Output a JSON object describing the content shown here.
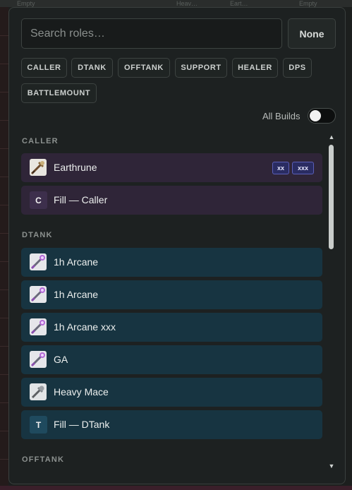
{
  "background": {
    "top_cells": [
      "Empty",
      "Heav…",
      "Eart…",
      "Empty"
    ]
  },
  "popup": {
    "search": {
      "placeholder": "Search roles…",
      "value": ""
    },
    "none_button": "None",
    "chips": [
      "CALLER",
      "DTANK",
      "OFFTANK",
      "SUPPORT",
      "HEALER",
      "DPS",
      "BATTLEMOUNT"
    ],
    "all_builds": {
      "label": "All Builds",
      "enabled": false
    },
    "sections": [
      {
        "name": "CALLER",
        "rows": [
          {
            "label": "Earthrune",
            "icon": "staff-weapon-icon",
            "tags": [
              "xx",
              "xxx"
            ]
          },
          {
            "label": "Fill — Caller",
            "letter": "C"
          }
        ]
      },
      {
        "name": "DTANK",
        "rows": [
          {
            "label": "1h Arcane",
            "icon": "arcane-staff-icon"
          },
          {
            "label": "1h Arcane",
            "icon": "arcane-staff-icon"
          },
          {
            "label": "1h Arcane xxx",
            "icon": "arcane-staff-icon"
          },
          {
            "label": "GA",
            "icon": "arcane-staff-icon"
          },
          {
            "label": "Heavy Mace",
            "icon": "mace-weapon-icon"
          },
          {
            "label": "Fill — DTank",
            "letter": "T"
          }
        ]
      },
      {
        "name": "OFFTANK",
        "rows": []
      }
    ],
    "colors": {
      "caller_row": "#2f2538",
      "dtank_row": "#173441",
      "tag_border": "#5b5fb8",
      "tag_bg": "#2a2c62"
    }
  }
}
